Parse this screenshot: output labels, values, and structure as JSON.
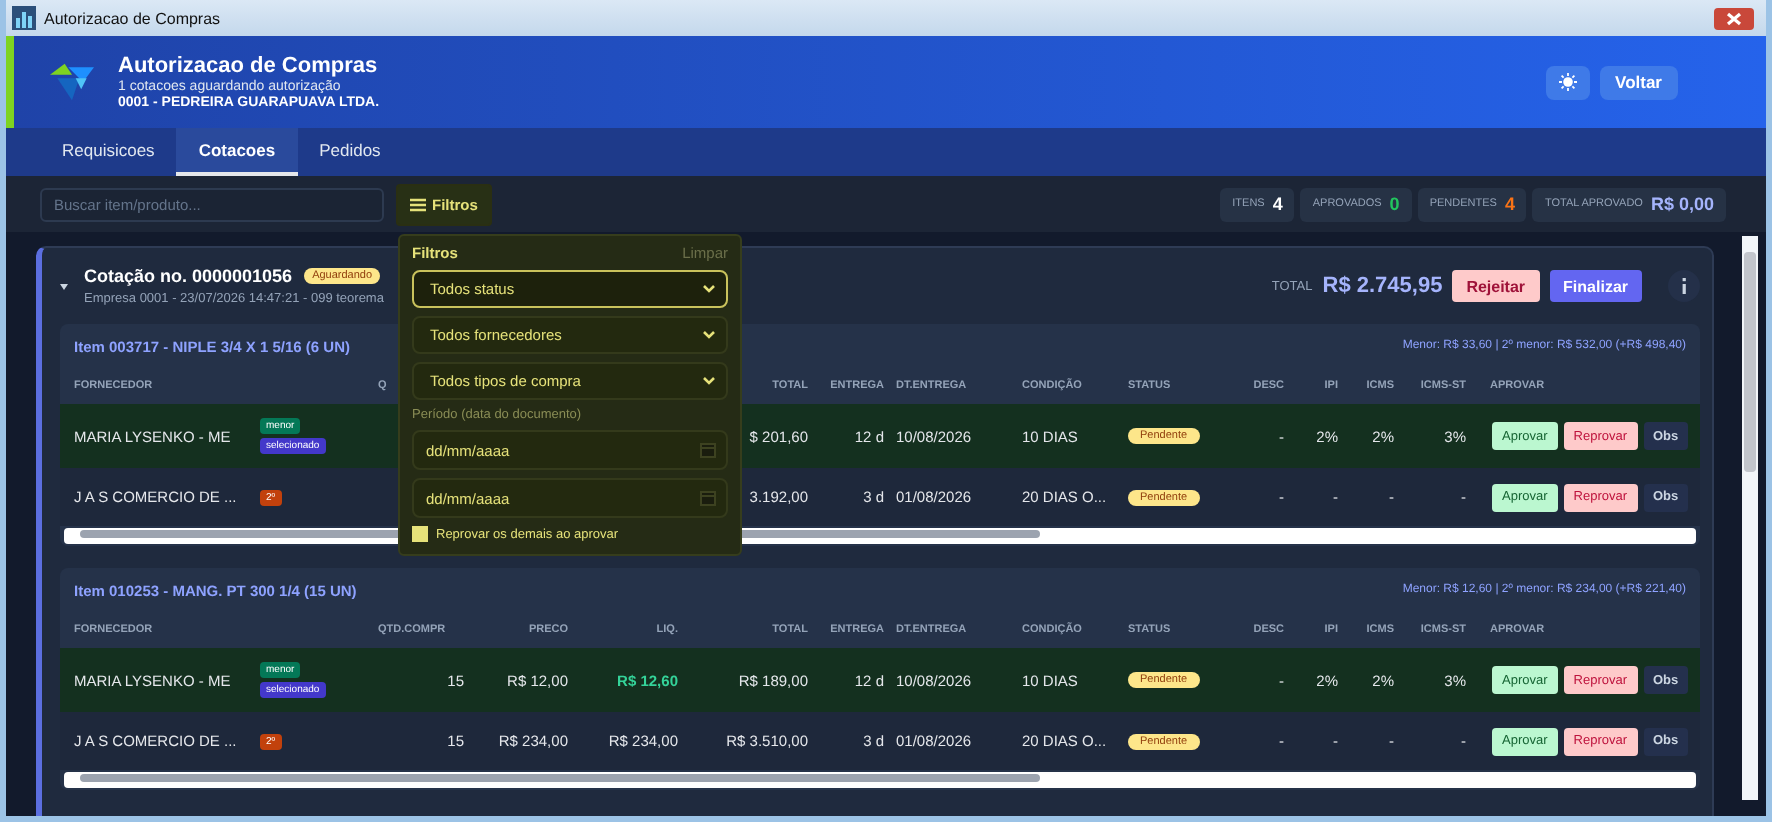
{
  "window": {
    "title": "Autorizacao de Compras"
  },
  "header": {
    "title": "Autorizacao de Compras",
    "subtitle": "1 cotacoes aguardando autorização",
    "company": "0001 - PEDREIRA GUARAPUAVA LTDA.",
    "back_button": "Voltar"
  },
  "tabs": [
    {
      "label": "Requisicoes",
      "selected": false
    },
    {
      "label": "Cotacoes",
      "selected": true
    },
    {
      "label": "Pedidos",
      "selected": false
    }
  ],
  "search": {
    "placeholder": "Buscar item/produto..."
  },
  "filter_button": {
    "label": "Filtros"
  },
  "stats": [
    {
      "label": "ITENS",
      "value": "4",
      "color": "#ffffff"
    },
    {
      "label": "APROVADOS",
      "value": "0",
      "color": "#22c55e"
    },
    {
      "label": "PENDENTES",
      "value": "4",
      "color": "#f97316"
    },
    {
      "label": "TOTAL APROVADO",
      "value": "R$ 0,00",
      "color": "#a5b4fc"
    }
  ],
  "filter_panel": {
    "title": "Filtros",
    "clear": "Limpar",
    "selects": [
      {
        "value": "Todos status",
        "focused": true
      },
      {
        "value": "Todos fornecedores",
        "focused": false
      },
      {
        "value": "Todos tipos de compra",
        "focused": false
      }
    ],
    "period_label": "Período (data do documento)",
    "dates": [
      {
        "placeholder": "dd/mm/aaaa"
      },
      {
        "placeholder": "dd/mm/aaaa"
      }
    ],
    "option": {
      "label": "Reprovar os demais ao aprovar",
      "checked": true
    }
  },
  "quote": {
    "title": "Cotação no. 0000001056",
    "status": "Aguardando",
    "meta": "Empresa 0001 - 23/07/2026 14:47:21 - 099 teorema",
    "total_label": "TOTAL",
    "total": "R$ 2.745,95",
    "actions": [
      {
        "label": "Rejeitar",
        "kind": "reject"
      },
      {
        "label": "Finalizar",
        "kind": "finish"
      }
    ]
  },
  "items": [
    {
      "title": "Item 003717 - NIPLE 3/4 X 1 5/16 (6 UN)",
      "summary": "Menor: R$ 33,60 | 2º menor: R$ 532,00 (+R$ 498,40)",
      "headers": {
        "fornecedor": "FORNECEDOR",
        "qtd": "Q",
        "total": "TOTAL",
        "entrega": "ENTREGA",
        "dt_entrega": "DT.ENTREGA",
        "condicao": "CONDIÇÃO",
        "status": "STATUS",
        "desc": "DESC",
        "ipi": "IPI",
        "icms": "ICMS",
        "icms_st": "ICMS-ST",
        "aprovar": "APROVAR"
      },
      "rows": [
        {
          "fornecedor": "MARIA LYSENKO - ME",
          "selected": true,
          "tags": [
            {
              "label": "menor",
              "kind": "lowest"
            },
            {
              "label": "selecionado",
              "kind": "chosen"
            }
          ],
          "total": "$ 201,60",
          "entrega": "12 d",
          "dt_entrega": "10/08/2026",
          "condicao": "10 DIAS",
          "status": "Pendente",
          "desc": "-",
          "ipi": "2%",
          "icms": "2%",
          "icms_st": "3%",
          "actions": [
            {
              "label": "Aprovar",
              "kind": "approve"
            },
            {
              "label": "Reprovar",
              "kind": "reject"
            },
            {
              "label": "Obs",
              "kind": "note"
            }
          ]
        },
        {
          "fornecedor": "J A S COMERCIO DE ...",
          "selected": false,
          "tags": [
            {
              "label": "2º",
              "kind": "rank"
            }
          ],
          "total": "3.192,00",
          "entrega": "3 d",
          "dt_entrega": "01/08/2026",
          "condicao": "20 DIAS O...",
          "status": "Pendente",
          "desc": "-",
          "ipi": "-",
          "icms": "-",
          "icms_st": "-",
          "actions": [
            {
              "label": "Aprovar",
              "kind": "approve"
            },
            {
              "label": "Reprovar",
              "kind": "reject"
            },
            {
              "label": "Obs",
              "kind": "note"
            }
          ]
        }
      ]
    },
    {
      "title": "Item 010253 - MANG. PT 300 1/4 (15 UN)",
      "summary": "Menor: R$ 12,60 | 2º menor: R$ 234,00 (+R$ 221,40)",
      "headers": {
        "fornecedor": "FORNECEDOR",
        "qtd": "QTD.COMPR",
        "preco": "PRECO",
        "liq": "LIQ.",
        "total": "TOTAL",
        "entrega": "ENTREGA",
        "dt_entrega": "DT.ENTREGA",
        "condicao": "CONDIÇÃO",
        "status": "STATUS",
        "desc": "DESC",
        "ipi": "IPI",
        "icms": "ICMS",
        "icms_st": "ICMS-ST",
        "aprovar": "APROVAR"
      },
      "rows": [
        {
          "fornecedor": "MARIA LYSENKO - ME",
          "selected": true,
          "best_price": true,
          "tags": [
            {
              "label": "menor",
              "kind": "lowest"
            },
            {
              "label": "selecionado",
              "kind": "chosen"
            }
          ],
          "qtd": "15",
          "preco": "R$ 12,00",
          "liq": "R$ 12,60",
          "total": "R$ 189,00",
          "entrega": "12 d",
          "dt_entrega": "10/08/2026",
          "condicao": "10 DIAS",
          "status": "Pendente",
          "desc": "-",
          "ipi": "2%",
          "icms": "2%",
          "icms_st": "3%",
          "actions": [
            {
              "label": "Aprovar",
              "kind": "approve"
            },
            {
              "label": "Reprovar",
              "kind": "reject"
            },
            {
              "label": "Obs",
              "kind": "note"
            }
          ]
        },
        {
          "fornecedor": "J A S COMERCIO DE ...",
          "selected": false,
          "best_price": false,
          "tags": [
            {
              "label": "2º",
              "kind": "rank"
            }
          ],
          "qtd": "15",
          "preco": "R$ 234,00",
          "liq": "R$ 234,00",
          "total": "R$ 3.510,00",
          "entrega": "3 d",
          "dt_entrega": "01/08/2026",
          "condicao": "20 DIAS O...",
          "status": "Pendente",
          "desc": "-",
          "ipi": "-",
          "icms": "-",
          "icms_st": "-",
          "actions": [
            {
              "label": "Aprovar",
              "kind": "approve"
            },
            {
              "label": "Reprovar",
              "kind": "reject"
            },
            {
              "label": "Obs",
              "kind": "note"
            }
          ]
        }
      ]
    }
  ]
}
